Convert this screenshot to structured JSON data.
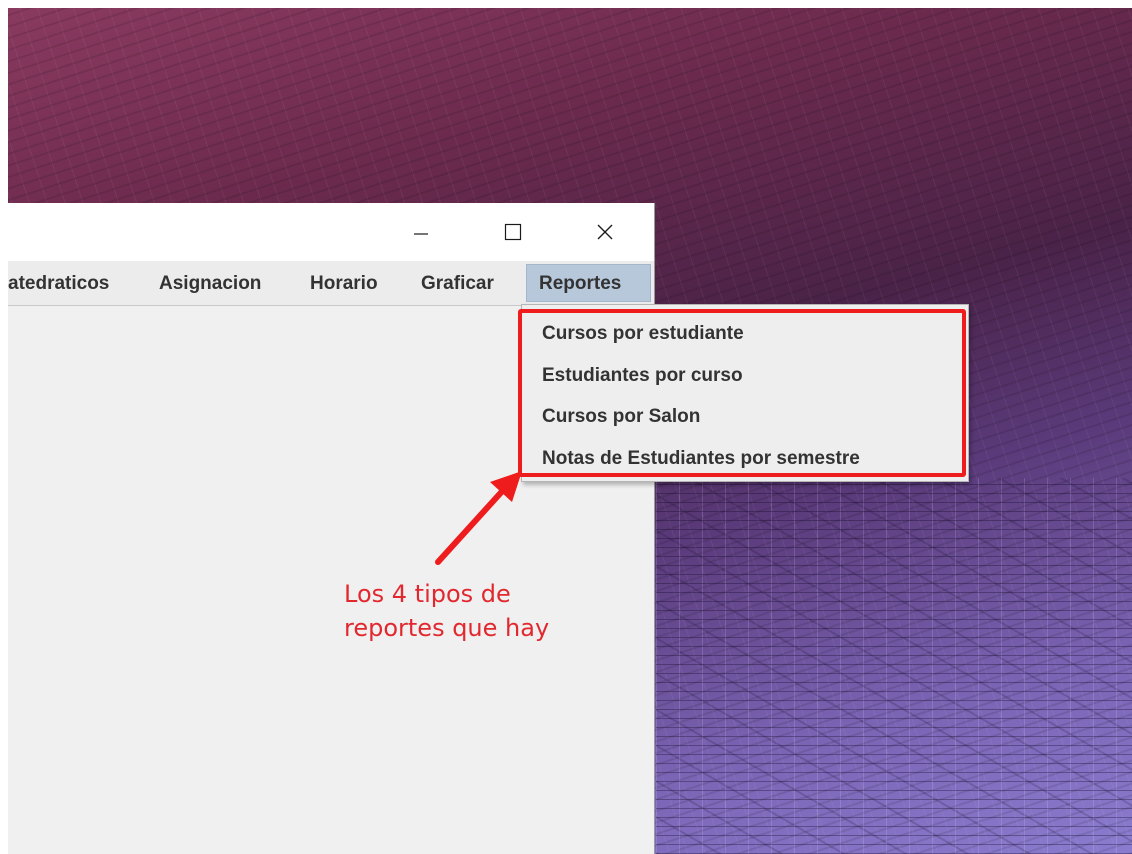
{
  "window": {
    "controls": {
      "minimize_icon": "minimize-icon",
      "maximize_icon": "maximize-icon",
      "close_icon": "close-icon"
    }
  },
  "menubar": {
    "items": [
      {
        "label": "atedraticos"
      },
      {
        "label": "Asignacion"
      },
      {
        "label": "Horario"
      },
      {
        "label": "Graficar"
      },
      {
        "label": "Reportes",
        "active": true
      }
    ]
  },
  "dropdown": {
    "items": [
      {
        "label": "Cursos por estudiante"
      },
      {
        "label": "Estudiantes por curso"
      },
      {
        "label": "Cursos por Salon"
      },
      {
        "label": "Notas de Estudiantes por semestre"
      }
    ]
  },
  "annotation": {
    "line1": "Los 4 tipos de",
    "line2": "reportes que hay",
    "color": "#e2282f"
  },
  "colors": {
    "highlight": "#ee1c1c",
    "active_menu": "#b8c8db",
    "window_bg": "#f0f0f0"
  }
}
